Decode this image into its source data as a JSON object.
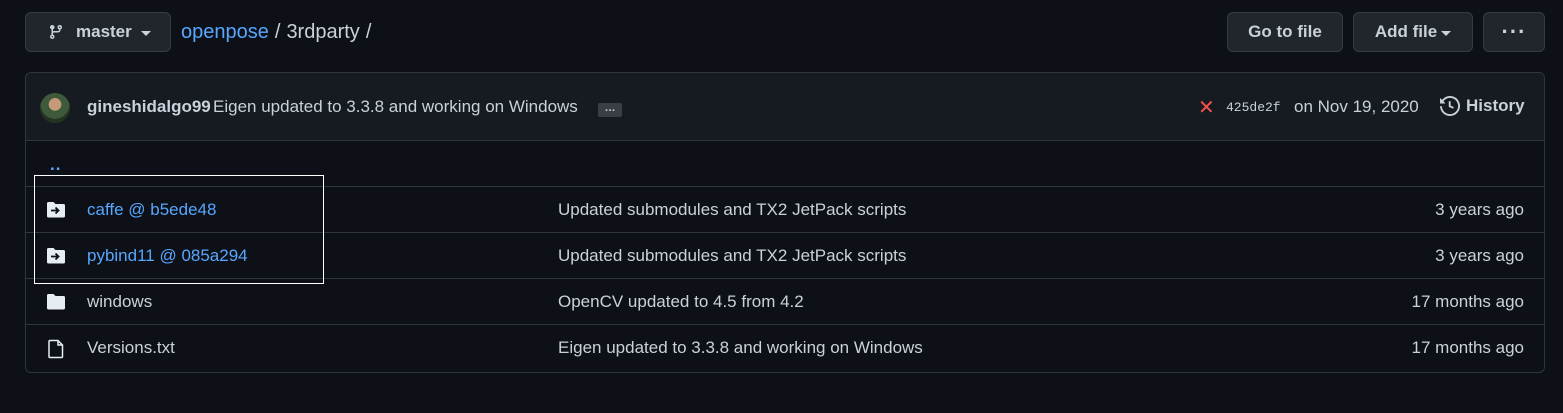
{
  "toolbar": {
    "branch": "master",
    "breadcrumb": {
      "repo": "openpose",
      "separator1": "/",
      "folder": "3rdparty",
      "separator2": "/"
    },
    "go_to_file": "Go to file",
    "add_file": "Add file",
    "more": "···"
  },
  "commit": {
    "author": "gineshidalgo99",
    "message": "Eigen updated to 3.3.8 and working on Windows",
    "ellipsis": "…",
    "status": "✕",
    "sha": "425de2f",
    "date": "on Nov 19, 2020",
    "history": "History"
  },
  "updir": "..",
  "files": [
    {
      "icon": "submodule-icon",
      "name": "caffe @ b5ede48",
      "message": "Updated submodules and TX2 JetPack scripts",
      "age": "3 years ago",
      "link": true
    },
    {
      "icon": "submodule-icon",
      "name": "pybind11 @ 085a294",
      "message": "Updated submodules and TX2 JetPack scripts",
      "age": "3 years ago",
      "link": true
    },
    {
      "icon": "folder-icon",
      "name": "windows",
      "message": "OpenCV updated to 4.5 from 4.2",
      "age": "17 months ago",
      "link": false
    },
    {
      "icon": "file-icon",
      "name": "Versions.txt",
      "message": "Eigen updated to 3.3.8 and working on Windows",
      "age": "17 months ago",
      "link": false
    }
  ],
  "colors": {
    "background": "#0d1117",
    "link": "#58a6ff",
    "error": "#f85149",
    "border": "#30363d"
  }
}
